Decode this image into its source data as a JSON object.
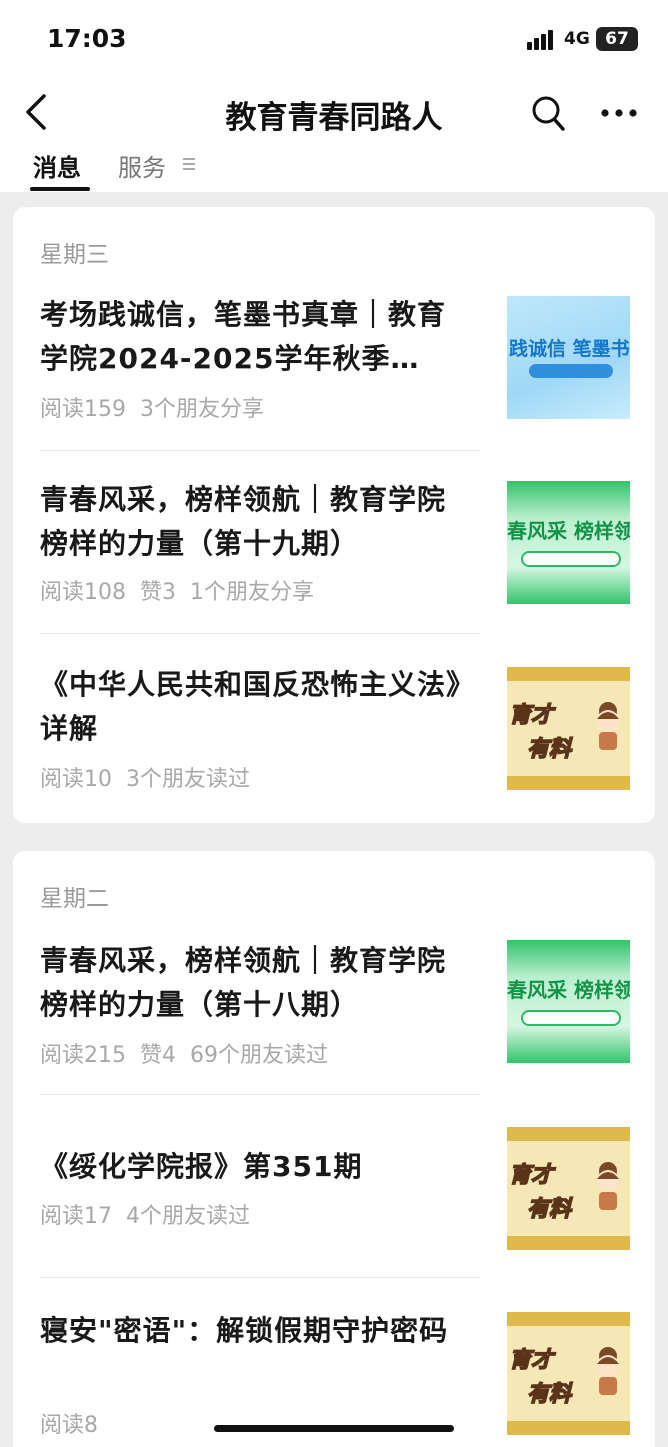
{
  "status_bar": {
    "time": "17:03",
    "network": "4G",
    "battery": "67"
  },
  "nav": {
    "title": "教育青春同路人"
  },
  "tabs": [
    {
      "label": "消息"
    },
    {
      "label": "服务"
    }
  ],
  "groups": [
    {
      "day": "星期三",
      "articles": [
        {
          "title": "考场践诚信，笔墨书真章｜教育学院2024-2025学年秋季…",
          "meta": [
            "阅读159",
            "3个朋友分享"
          ],
          "thumb_text": "践诚信 笔墨书"
        },
        {
          "title": "青春风采，榜样领航｜教育学院榜样的力量（第十九期）",
          "meta": [
            "阅读108",
            "赞3",
            "1个朋友分享"
          ],
          "thumb_text": "春风采 榜样领"
        },
        {
          "title": "《中华人民共和国反恐怖主义法》详解",
          "meta": [
            "阅读10",
            "3个朋友读过"
          ],
          "thumb_text": [
            "育才",
            "有料"
          ]
        }
      ]
    },
    {
      "day": "星期二",
      "articles": [
        {
          "title": "青春风采，榜样领航｜教育学院榜样的力量（第十八期）",
          "meta": [
            "阅读215",
            "赞4",
            "69个朋友读过"
          ],
          "thumb_text": "春风采 榜样领"
        },
        {
          "title": "《绥化学院报》第351期",
          "meta": [
            "阅读17",
            "4个朋友读过"
          ],
          "thumb_text": [
            "育才",
            "有料"
          ]
        },
        {
          "title": "寝安\"密语\"：解锁假期守护密码",
          "meta": [
            "阅读8"
          ],
          "thumb_text": [
            "育才",
            "有料"
          ]
        }
      ]
    }
  ],
  "colors": {
    "background": "#ededed",
    "card": "#ffffff",
    "title_text": "#191919",
    "meta_text": "#a8a8a8"
  }
}
